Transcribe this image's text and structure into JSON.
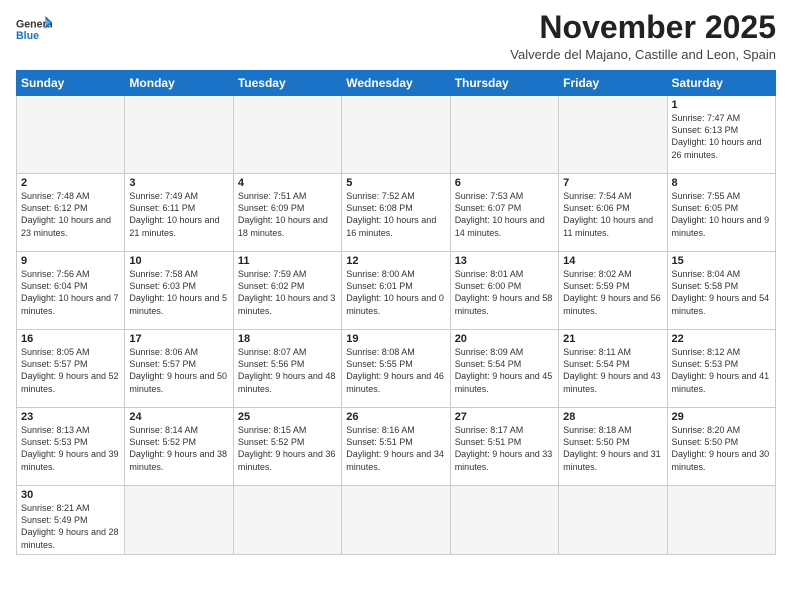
{
  "header": {
    "logo_general": "General",
    "logo_blue": "Blue",
    "month_title": "November 2025",
    "subtitle": "Valverde del Majano, Castille and Leon, Spain"
  },
  "weekdays": [
    "Sunday",
    "Monday",
    "Tuesday",
    "Wednesday",
    "Thursday",
    "Friday",
    "Saturday"
  ],
  "weeks": [
    [
      {
        "day": "",
        "info": ""
      },
      {
        "day": "",
        "info": ""
      },
      {
        "day": "",
        "info": ""
      },
      {
        "day": "",
        "info": ""
      },
      {
        "day": "",
        "info": ""
      },
      {
        "day": "",
        "info": ""
      },
      {
        "day": "1",
        "info": "Sunrise: 7:47 AM\nSunset: 6:13 PM\nDaylight: 10 hours\nand 26 minutes."
      }
    ],
    [
      {
        "day": "2",
        "info": "Sunrise: 7:48 AM\nSunset: 6:12 PM\nDaylight: 10 hours\nand 23 minutes."
      },
      {
        "day": "3",
        "info": "Sunrise: 7:49 AM\nSunset: 6:11 PM\nDaylight: 10 hours\nand 21 minutes."
      },
      {
        "day": "4",
        "info": "Sunrise: 7:51 AM\nSunset: 6:09 PM\nDaylight: 10 hours\nand 18 minutes."
      },
      {
        "day": "5",
        "info": "Sunrise: 7:52 AM\nSunset: 6:08 PM\nDaylight: 10 hours\nand 16 minutes."
      },
      {
        "day": "6",
        "info": "Sunrise: 7:53 AM\nSunset: 6:07 PM\nDaylight: 10 hours\nand 14 minutes."
      },
      {
        "day": "7",
        "info": "Sunrise: 7:54 AM\nSunset: 6:06 PM\nDaylight: 10 hours\nand 11 minutes."
      },
      {
        "day": "8",
        "info": "Sunrise: 7:55 AM\nSunset: 6:05 PM\nDaylight: 10 hours\nand 9 minutes."
      }
    ],
    [
      {
        "day": "9",
        "info": "Sunrise: 7:56 AM\nSunset: 6:04 PM\nDaylight: 10 hours\nand 7 minutes."
      },
      {
        "day": "10",
        "info": "Sunrise: 7:58 AM\nSunset: 6:03 PM\nDaylight: 10 hours\nand 5 minutes."
      },
      {
        "day": "11",
        "info": "Sunrise: 7:59 AM\nSunset: 6:02 PM\nDaylight: 10 hours\nand 3 minutes."
      },
      {
        "day": "12",
        "info": "Sunrise: 8:00 AM\nSunset: 6:01 PM\nDaylight: 10 hours\nand 0 minutes."
      },
      {
        "day": "13",
        "info": "Sunrise: 8:01 AM\nSunset: 6:00 PM\nDaylight: 9 hours\nand 58 minutes."
      },
      {
        "day": "14",
        "info": "Sunrise: 8:02 AM\nSunset: 5:59 PM\nDaylight: 9 hours\nand 56 minutes."
      },
      {
        "day": "15",
        "info": "Sunrise: 8:04 AM\nSunset: 5:58 PM\nDaylight: 9 hours\nand 54 minutes."
      }
    ],
    [
      {
        "day": "16",
        "info": "Sunrise: 8:05 AM\nSunset: 5:57 PM\nDaylight: 9 hours\nand 52 minutes."
      },
      {
        "day": "17",
        "info": "Sunrise: 8:06 AM\nSunset: 5:57 PM\nDaylight: 9 hours\nand 50 minutes."
      },
      {
        "day": "18",
        "info": "Sunrise: 8:07 AM\nSunset: 5:56 PM\nDaylight: 9 hours\nand 48 minutes."
      },
      {
        "day": "19",
        "info": "Sunrise: 8:08 AM\nSunset: 5:55 PM\nDaylight: 9 hours\nand 46 minutes."
      },
      {
        "day": "20",
        "info": "Sunrise: 8:09 AM\nSunset: 5:54 PM\nDaylight: 9 hours\nand 45 minutes."
      },
      {
        "day": "21",
        "info": "Sunrise: 8:11 AM\nSunset: 5:54 PM\nDaylight: 9 hours\nand 43 minutes."
      },
      {
        "day": "22",
        "info": "Sunrise: 8:12 AM\nSunset: 5:53 PM\nDaylight: 9 hours\nand 41 minutes."
      }
    ],
    [
      {
        "day": "23",
        "info": "Sunrise: 8:13 AM\nSunset: 5:53 PM\nDaylight: 9 hours\nand 39 minutes."
      },
      {
        "day": "24",
        "info": "Sunrise: 8:14 AM\nSunset: 5:52 PM\nDaylight: 9 hours\nand 38 minutes."
      },
      {
        "day": "25",
        "info": "Sunrise: 8:15 AM\nSunset: 5:52 PM\nDaylight: 9 hours\nand 36 minutes."
      },
      {
        "day": "26",
        "info": "Sunrise: 8:16 AM\nSunset: 5:51 PM\nDaylight: 9 hours\nand 34 minutes."
      },
      {
        "day": "27",
        "info": "Sunrise: 8:17 AM\nSunset: 5:51 PM\nDaylight: 9 hours\nand 33 minutes."
      },
      {
        "day": "28",
        "info": "Sunrise: 8:18 AM\nSunset: 5:50 PM\nDaylight: 9 hours\nand 31 minutes."
      },
      {
        "day": "29",
        "info": "Sunrise: 8:20 AM\nSunset: 5:50 PM\nDaylight: 9 hours\nand 30 minutes."
      }
    ],
    [
      {
        "day": "30",
        "info": "Sunrise: 8:21 AM\nSunset: 5:49 PM\nDaylight: 9 hours\nand 28 minutes."
      },
      {
        "day": "",
        "info": ""
      },
      {
        "day": "",
        "info": ""
      },
      {
        "day": "",
        "info": ""
      },
      {
        "day": "",
        "info": ""
      },
      {
        "day": "",
        "info": ""
      },
      {
        "day": "",
        "info": ""
      }
    ]
  ]
}
